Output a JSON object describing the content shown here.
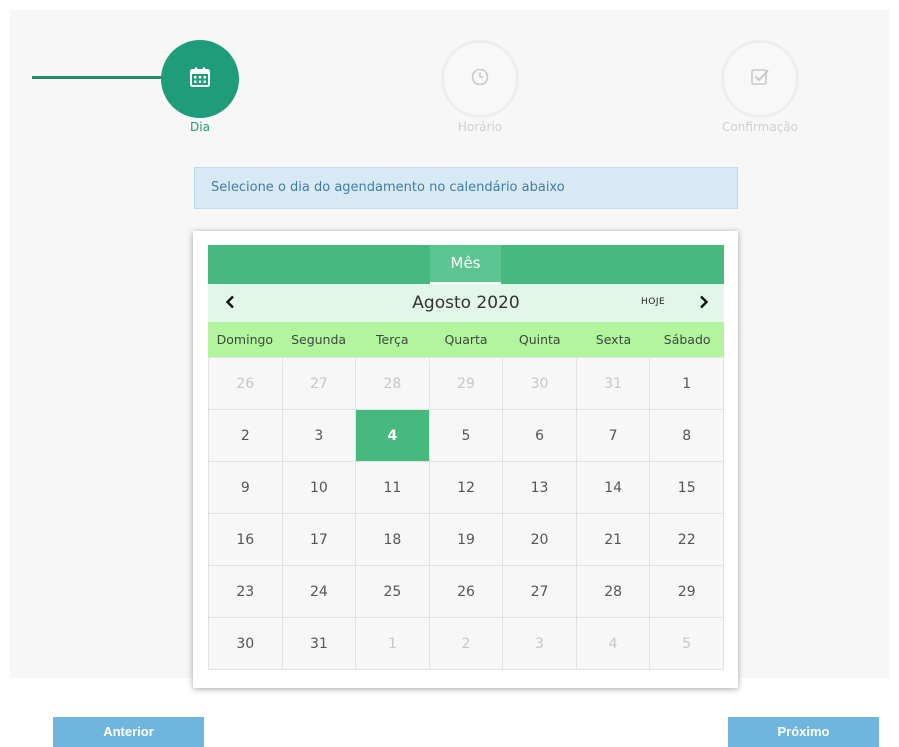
{
  "stepper": {
    "steps": [
      {
        "label": "Dia",
        "icon": "calendar-icon",
        "state": "active"
      },
      {
        "label": "Horário",
        "icon": "clock-icon",
        "state": "inactive"
      },
      {
        "label": "Confirmação",
        "icon": "checkbox-icon",
        "state": "inactive"
      }
    ]
  },
  "info": {
    "text": "Selecione o dia do agendamento no calendário abaixo"
  },
  "calendar": {
    "view_tab": "Mês",
    "month_title": "Agosto 2020",
    "today_button": "HOJE",
    "weekdays": [
      "Domingo",
      "Segunda",
      "Terça",
      "Quarta",
      "Quinta",
      "Sexta",
      "Sábado"
    ],
    "weeks": [
      [
        {
          "d": "26",
          "m": true
        },
        {
          "d": "27",
          "m": true
        },
        {
          "d": "28",
          "m": true
        },
        {
          "d": "29",
          "m": true
        },
        {
          "d": "30",
          "m": true
        },
        {
          "d": "31",
          "m": true
        },
        {
          "d": "1"
        }
      ],
      [
        {
          "d": "2"
        },
        {
          "d": "3"
        },
        {
          "d": "4",
          "sel": true
        },
        {
          "d": "5"
        },
        {
          "d": "6"
        },
        {
          "d": "7"
        },
        {
          "d": "8"
        }
      ],
      [
        {
          "d": "9"
        },
        {
          "d": "10"
        },
        {
          "d": "11"
        },
        {
          "d": "12"
        },
        {
          "d": "13"
        },
        {
          "d": "14"
        },
        {
          "d": "15"
        }
      ],
      [
        {
          "d": "16"
        },
        {
          "d": "17"
        },
        {
          "d": "18"
        },
        {
          "d": "19"
        },
        {
          "d": "20"
        },
        {
          "d": "21"
        },
        {
          "d": "22"
        }
      ],
      [
        {
          "d": "23"
        },
        {
          "d": "24"
        },
        {
          "d": "25"
        },
        {
          "d": "26"
        },
        {
          "d": "27"
        },
        {
          "d": "28"
        },
        {
          "d": "29"
        }
      ],
      [
        {
          "d": "30"
        },
        {
          "d": "31"
        },
        {
          "d": "1",
          "m": true
        },
        {
          "d": "2",
          "m": true
        },
        {
          "d": "3",
          "m": true
        },
        {
          "d": "4",
          "m": true
        },
        {
          "d": "5",
          "m": true
        }
      ]
    ],
    "selected_day": "4"
  },
  "buttons": {
    "previous": "Anterior",
    "next": "Próximo"
  },
  "colors": {
    "accent": "#1f9c7a",
    "calendar_header": "#46b97f",
    "weekday_row": "#b2f59e",
    "button": "#6eb6dd",
    "info_bg": "#d6e9f4"
  }
}
